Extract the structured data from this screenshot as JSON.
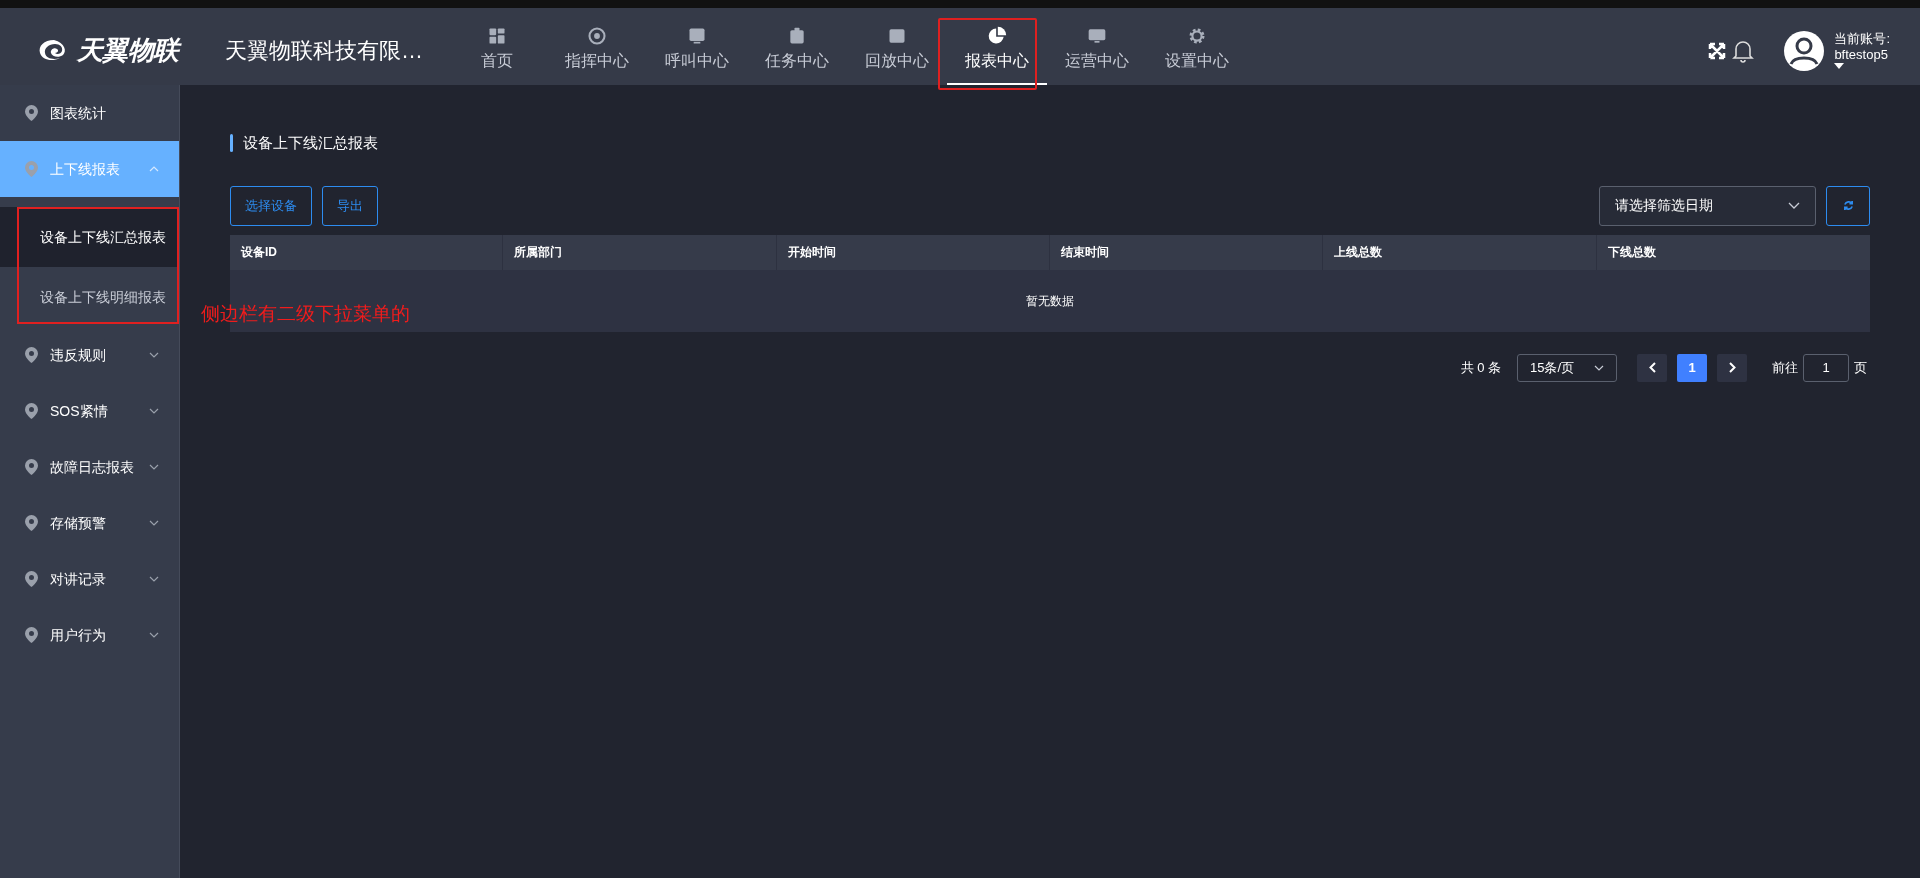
{
  "header": {
    "logo_text": "天翼物联",
    "company": "天翼物联科技有限…",
    "nav": [
      {
        "label": "首页",
        "selected": false
      },
      {
        "label": "指挥中心",
        "selected": false
      },
      {
        "label": "呼叫中心",
        "selected": false
      },
      {
        "label": "任务中心",
        "selected": false
      },
      {
        "label": "回放中心",
        "selected": false
      },
      {
        "label": "报表中心",
        "selected": true
      },
      {
        "label": "运营中心",
        "selected": false
      },
      {
        "label": "设置中心",
        "selected": false
      }
    ],
    "account_label": "当前账号:",
    "account_name": "bftestop5"
  },
  "sidebar": {
    "items": [
      {
        "label": "图表统计",
        "selected": false
      },
      {
        "label": "上下线报表",
        "selected": true,
        "expanded": true,
        "children": [
          {
            "label": "设备上下线汇总报表",
            "selected": true
          },
          {
            "label": "设备上下线明细报表",
            "selected": false
          }
        ]
      },
      {
        "label": "违反规则",
        "selected": false,
        "expanded": false
      },
      {
        "label": "SOS紧情",
        "selected": false,
        "expanded": false
      },
      {
        "label": "故障日志报表",
        "selected": false,
        "expanded": false
      },
      {
        "label": "存储预警",
        "selected": false,
        "expanded": false
      },
      {
        "label": "对讲记录",
        "selected": false,
        "expanded": false
      },
      {
        "label": "用户行为",
        "selected": false,
        "expanded": false
      }
    ]
  },
  "annotation": {
    "text": "侧边栏有二级下拉菜单的"
  },
  "main": {
    "title": "设备上下线汇总报表",
    "buttons": [
      "选择设备",
      "导出"
    ],
    "date_select": {
      "placeholder": "请选择筛选日期"
    },
    "table": {
      "columns": [
        "设备ID",
        "所属部门",
        "开始时间",
        "结束时间",
        "上线总数",
        "下线总数"
      ],
      "empty_text": "暂无数据"
    },
    "pagination": {
      "total": "共 0 条",
      "page_size": "15条/页",
      "pages": [
        {
          "label": "1",
          "selected": true
        }
      ],
      "goto_label": "前往",
      "goto_value": "1",
      "goto_suffix": "页"
    }
  }
}
